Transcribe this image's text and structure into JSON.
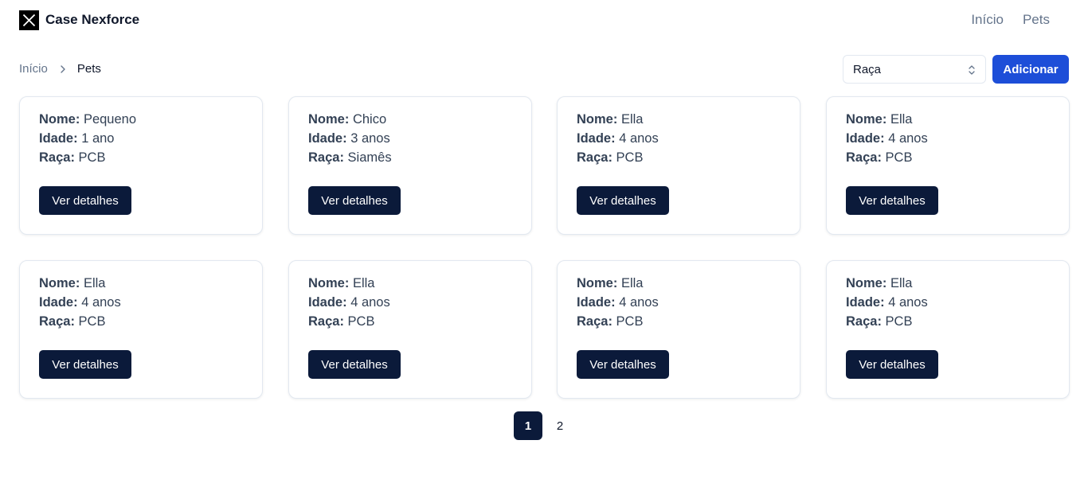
{
  "header": {
    "brand": "Case Nexforce",
    "nav": [
      {
        "label": "Início"
      },
      {
        "label": "Pets"
      }
    ]
  },
  "breadcrumb": {
    "home": "Início",
    "current": "Pets"
  },
  "filter": {
    "selected": "Raça"
  },
  "actions": {
    "add_label": "Adicionar"
  },
  "labels": {
    "name": "Nome:",
    "age": "Idade:",
    "breed": "Raça:",
    "details": "Ver detalhes"
  },
  "pets": [
    {
      "nome": "Pequeno",
      "idade": "1 ano",
      "raca": "PCB"
    },
    {
      "nome": "Chico",
      "idade": "3 anos",
      "raca": "Siamês"
    },
    {
      "nome": "Ella",
      "idade": "4 anos",
      "raca": "PCB"
    },
    {
      "nome": "Ella",
      "idade": "4 anos",
      "raca": "PCB"
    },
    {
      "nome": "Ella",
      "idade": "4 anos",
      "raca": "PCB"
    },
    {
      "nome": "Ella",
      "idade": "4 anos",
      "raca": "PCB"
    },
    {
      "nome": "Ella",
      "idade": "4 anos",
      "raca": "PCB"
    },
    {
      "nome": "Ella",
      "idade": "4 anos",
      "raca": "PCB"
    }
  ],
  "pagination": {
    "pages": [
      "1",
      "2"
    ],
    "current": "1"
  },
  "colors": {
    "primary": "#1d4ed8",
    "dark": "#0b1a3a",
    "muted": "#64748b",
    "border": "#e2e8f0"
  }
}
